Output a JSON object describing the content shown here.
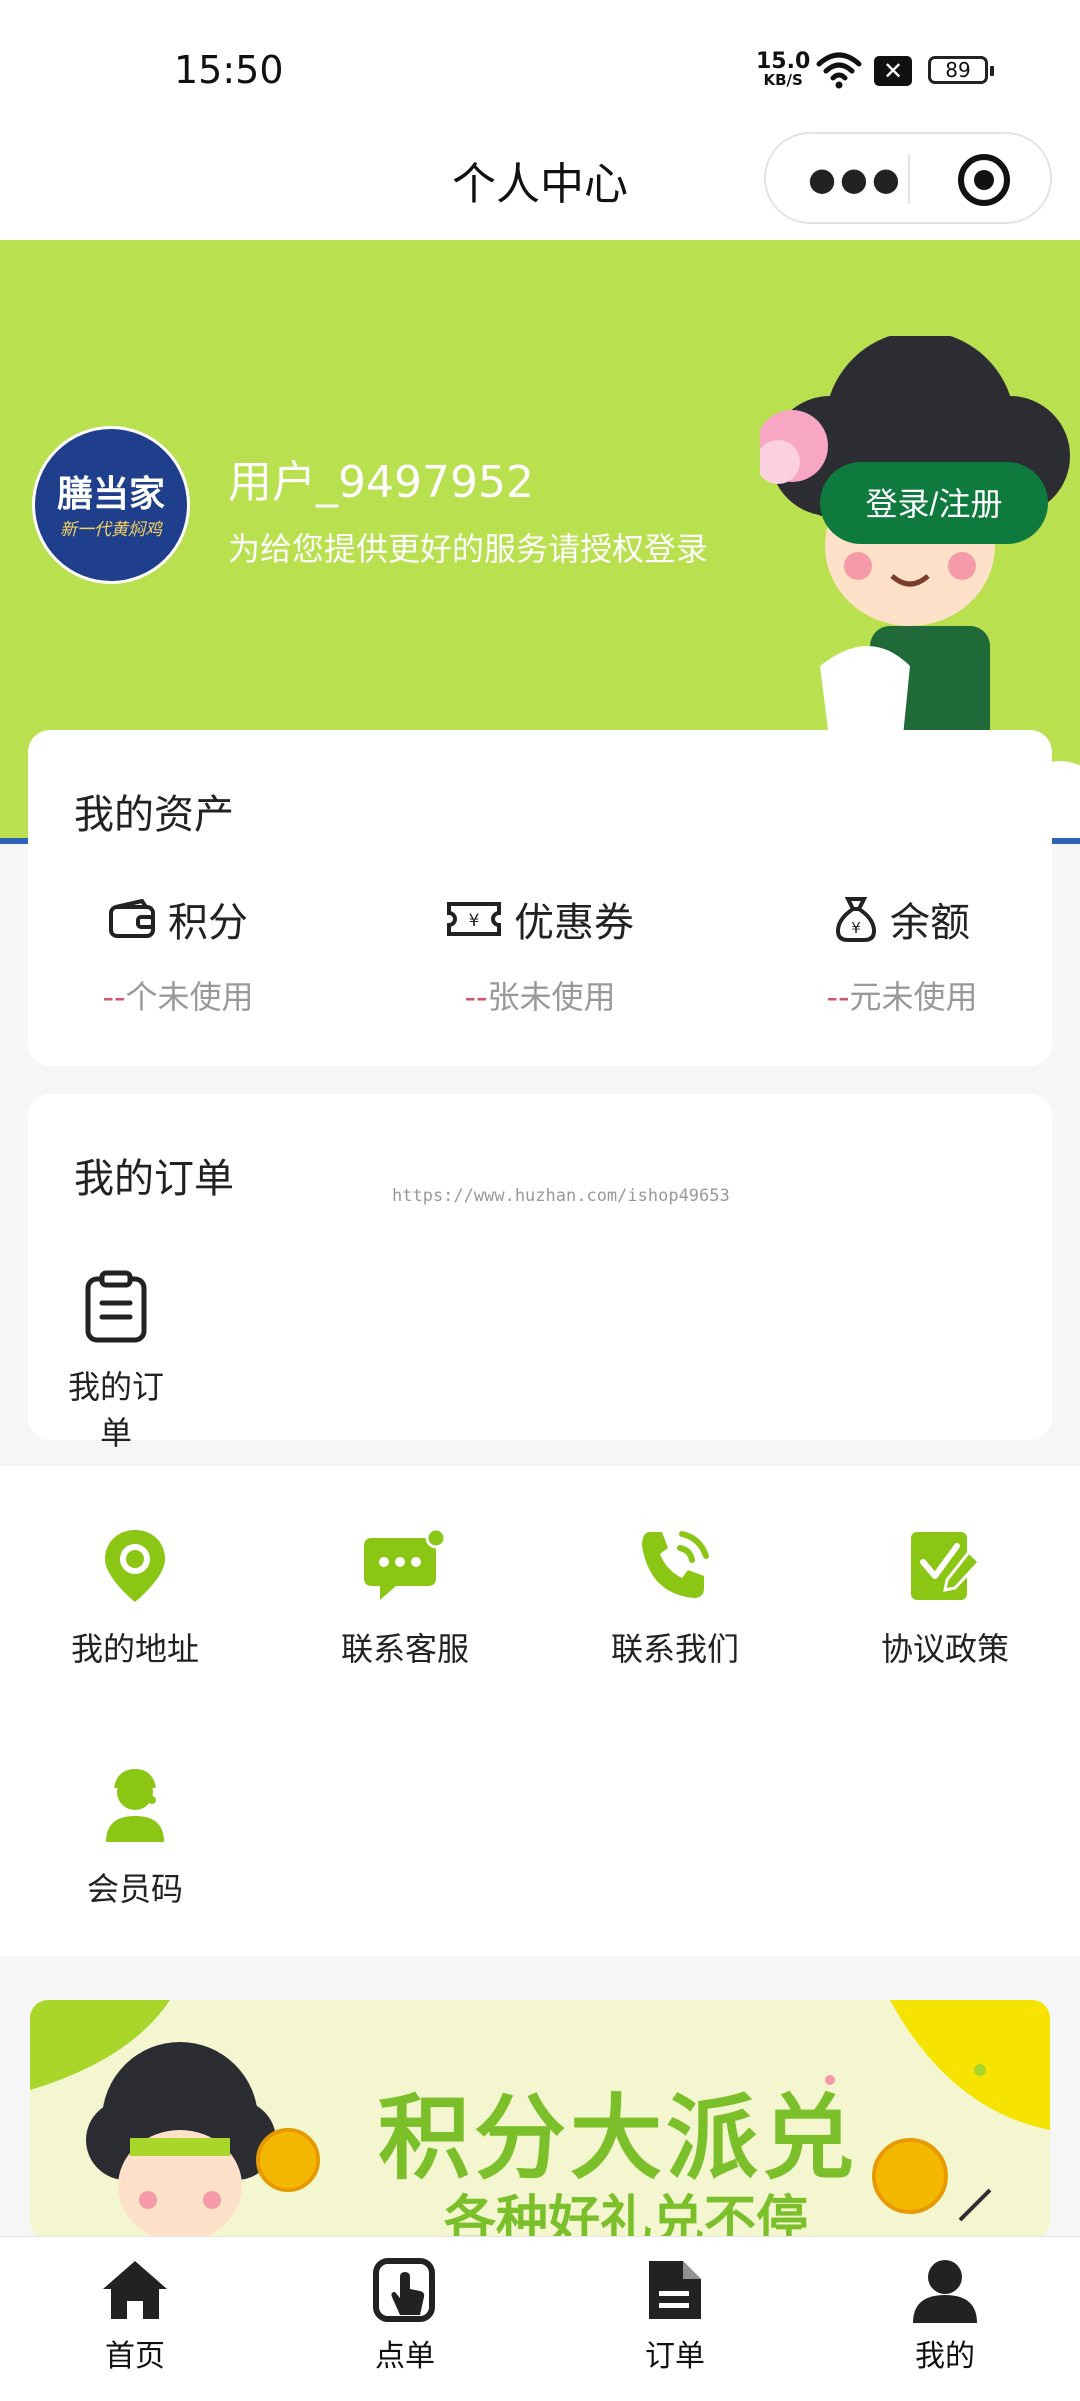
{
  "status_bar": {
    "time": "15:50",
    "network_speed_value": "15.0",
    "network_speed_unit": "KB/S",
    "battery": "89",
    "icons": [
      "wifi-icon",
      "sim-off-icon",
      "battery-icon"
    ]
  },
  "navbar": {
    "title": "个人中心",
    "more_icon": "more-dots-icon",
    "close_icon": "target-circle-icon"
  },
  "profile": {
    "logo_line1": "膳当家",
    "logo_line2": "新一代黄焖鸡",
    "username": "用户_9497952",
    "tip": "为给您提供更好的服务请授权登录",
    "login_button": "登录/注册",
    "colors": {
      "hero_bg": "#b8e04f",
      "login_btn": "#0f7a3e"
    }
  },
  "assets": {
    "title": "我的资产",
    "items": [
      {
        "icon": "wallet-icon",
        "label": "积分",
        "dash": "--",
        "sub": "个未使用"
      },
      {
        "icon": "coupon-icon",
        "label": "优惠券",
        "dash": "--",
        "sub": "张未使用"
      },
      {
        "icon": "money-bag-icon",
        "label": "余额",
        "dash": "--",
        "sub": "元未使用"
      }
    ]
  },
  "orders": {
    "title": "我的订单",
    "watermark": "https://www.huzhan.com/ishop49653",
    "items": [
      {
        "icon": "clipboard-icon",
        "label": "我的订单"
      }
    ]
  },
  "services": {
    "accent": "#8bc614",
    "items": [
      {
        "icon": "location-pin-icon",
        "label": "我的地址"
      },
      {
        "icon": "chat-bubble-icon",
        "label": "联系客服"
      },
      {
        "icon": "phone-icon",
        "label": "联系我们"
      },
      {
        "icon": "agreement-icon",
        "label": "协议政策"
      },
      {
        "icon": "member-icon",
        "label": "会员码"
      }
    ]
  },
  "banner": {
    "title": "积分大派兑",
    "subtitle": "各种好礼兑不停"
  },
  "tabbar": {
    "items": [
      {
        "icon": "home-icon",
        "label": "首页"
      },
      {
        "icon": "tap-order-icon",
        "label": "点单"
      },
      {
        "icon": "document-icon",
        "label": "订单"
      },
      {
        "icon": "person-icon",
        "label": "我的"
      }
    ]
  }
}
